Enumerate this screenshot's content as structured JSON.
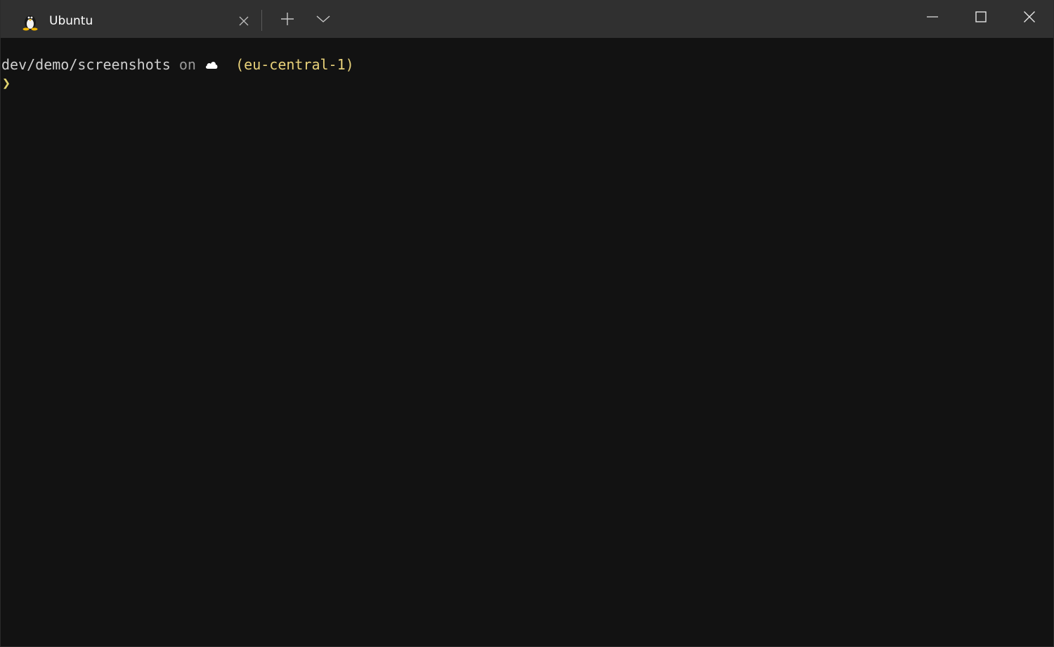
{
  "window": {
    "tab": {
      "title": "Ubuntu",
      "icon": "linux-penguin-icon"
    },
    "controls": {
      "new_tab_icon": "plus-icon",
      "dropdown_icon": "chevron-down-icon",
      "minimize_icon": "minimize-icon",
      "maximize_icon": "maximize-icon",
      "close_icon": "close-icon"
    }
  },
  "terminal": {
    "prompt": {
      "path": "dev/demo/screenshots",
      "on": "on",
      "cloud_icon": "cloud-icon",
      "region": "(eu-central-1)",
      "caret": "❯"
    }
  },
  "colors": {
    "titlebar": "#303030",
    "terminal_bg": "#121212",
    "region_text": "#e9d27a",
    "caret": "#e0d36f"
  }
}
